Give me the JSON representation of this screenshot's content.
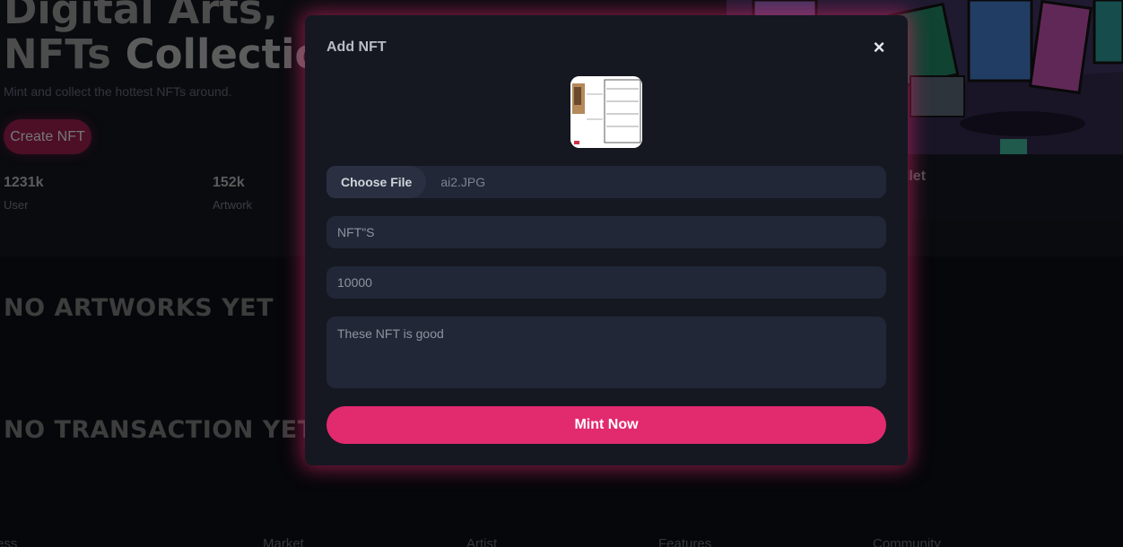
{
  "hero": {
    "title_line1": "Digital Arts,",
    "title_line2_a": "NFTs",
    "title_line2_b": "Collectio",
    "subtitle": "Mint and collect the hottest NFTs around.",
    "create_button": "Create NFT",
    "stats": [
      {
        "value": "1231k",
        "label": "User"
      },
      {
        "value": "152k",
        "label": "Artwork"
      }
    ],
    "wallet_text": "allet"
  },
  "sections": {
    "artworks_empty": "NO ARTWORKS YET",
    "transactions_empty": "NO TRANSACTION YET"
  },
  "footer": {
    "links": [
      "ess",
      "Market",
      "Artist",
      "Features",
      "Community"
    ]
  },
  "modal": {
    "title": "Add NFT",
    "close_glyph": "×",
    "file": {
      "button_label": "Choose File",
      "file_name": "ai2.JPG"
    },
    "name_value": "NFT\"S",
    "price_value": "10000",
    "description_value": "These NFT is good",
    "submit_label": "Mint Now"
  },
  "colors": {
    "accent": "#e22a6f",
    "modal_bg": "#151821",
    "field_bg": "#212736"
  }
}
